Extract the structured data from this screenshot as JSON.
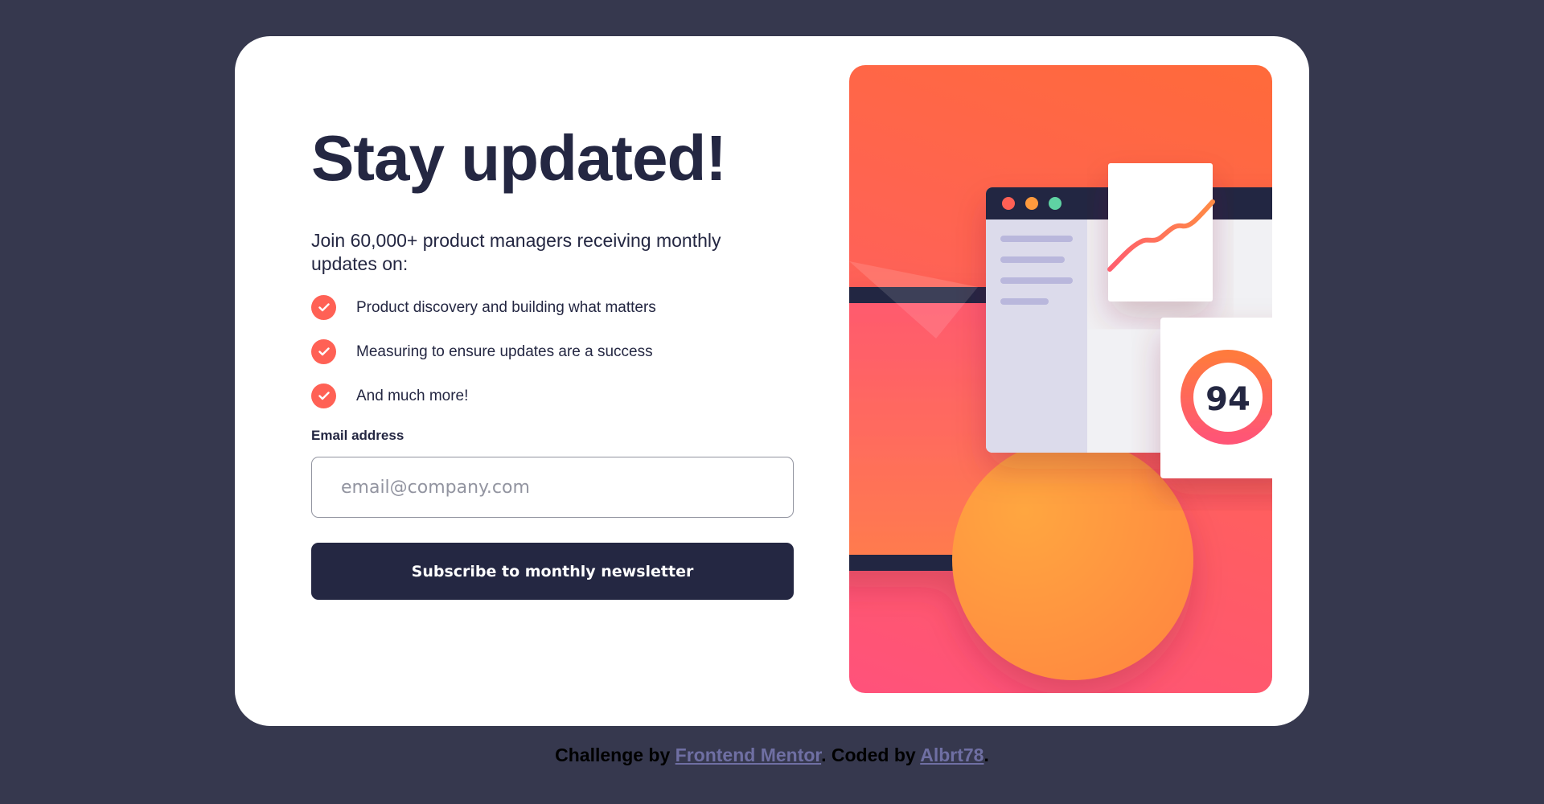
{
  "hero": {
    "title": "Stay updated!",
    "intro": "Join 60,000+ product managers receiving monthly updates on:"
  },
  "features": [
    "Product discovery and building what matters",
    "Measuring to ensure updates are a success",
    "And much more!"
  ],
  "form": {
    "email_label": "Email address",
    "email_placeholder": "email@company.com",
    "email_value": "",
    "submit_label": "Subscribe to monthly newsletter"
  },
  "illustration": {
    "score": "94",
    "icons": [
      "check-icon"
    ]
  },
  "footer": {
    "prefix": "Challenge by ",
    "link1": "Frontend Mentor",
    "middle": ". Coded by ",
    "link2": "Albrt78",
    "suffix": "."
  },
  "colors": {
    "page_bg": "#36384e",
    "card_bg": "#ffffff",
    "dark_navy": "#242742",
    "tomato": "#ff6155",
    "grey": "#9294a0",
    "link": "#6f6fa3"
  }
}
